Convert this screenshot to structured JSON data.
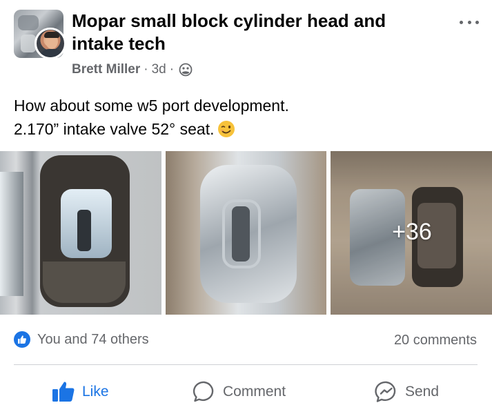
{
  "post": {
    "group_name": "Mopar small block cylinder head and intake tech",
    "author": "Brett Miller",
    "separator": "·",
    "time": "3d",
    "privacy_icon": "group-privacy-icon",
    "text_line1": "How about some w5 port development.",
    "text_line2": "2.170” intake valve 52° seat.",
    "emoji": "winking-face-emoji",
    "more_photos_label": "+36",
    "photo_count_visible": 3
  },
  "engagement": {
    "reactions_label": "You and 74 others",
    "comments_label": "20 comments"
  },
  "actions": {
    "like_label": "Like",
    "comment_label": "Comment",
    "send_label": "Send"
  },
  "colors": {
    "accent": "#1b74e4",
    "secondary_text": "#65676b",
    "primary_text": "#050505",
    "divider": "#ced0d4"
  }
}
